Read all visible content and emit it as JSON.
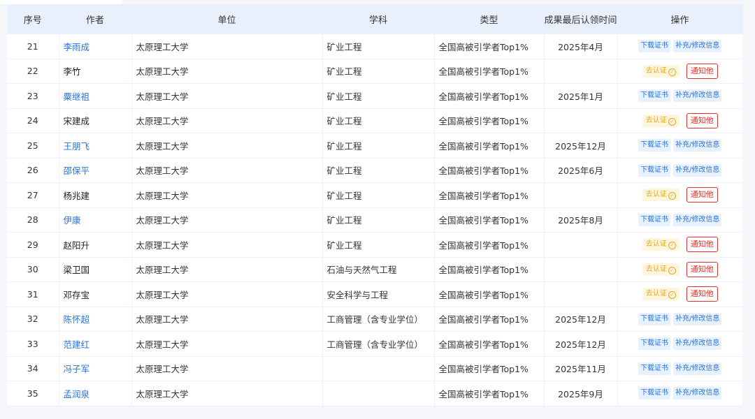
{
  "header": {
    "idx": "序号",
    "author": "作者",
    "unit": "单位",
    "subject": "学科",
    "type": "类型",
    "time": "成果最后认领时间",
    "ops": "操作"
  },
  "buttons": {
    "download": "下载证书",
    "edit": "补充/修改信息",
    "verify": "去认证",
    "notify": "通知他"
  },
  "colors": {
    "link": "#2a73d8",
    "notify": "#e0302a",
    "verify": "#e4a62a",
    "header_bg": "#eaf0fb"
  },
  "rows": [
    {
      "idx": "21",
      "author": "李雨成",
      "unit": "太原理工大学",
      "subject": "矿业工程",
      "type": "全国高被引学者Top1%",
      "time": "2025年4月",
      "claimed": true
    },
    {
      "idx": "22",
      "author": "李竹",
      "unit": "太原理工大学",
      "subject": "矿业工程",
      "type": "全国高被引学者Top1%",
      "time": "",
      "claimed": false
    },
    {
      "idx": "23",
      "author": "粟继祖",
      "unit": "太原理工大学",
      "subject": "矿业工程",
      "type": "全国高被引学者Top1%",
      "time": "2025年1月",
      "claimed": true
    },
    {
      "idx": "24",
      "author": "宋建成",
      "unit": "太原理工大学",
      "subject": "矿业工程",
      "type": "全国高被引学者Top1%",
      "time": "",
      "claimed": false
    },
    {
      "idx": "25",
      "author": "王朋飞",
      "unit": "太原理工大学",
      "subject": "矿业工程",
      "type": "全国高被引学者Top1%",
      "time": "2025年12月",
      "claimed": true
    },
    {
      "idx": "26",
      "author": "邵保平",
      "unit": "太原理工大学",
      "subject": "矿业工程",
      "type": "全国高被引学者Top1%",
      "time": "2025年6月",
      "claimed": true
    },
    {
      "idx": "27",
      "author": "杨兆建",
      "unit": "太原理工大学",
      "subject": "矿业工程",
      "type": "全国高被引学者Top1%",
      "time": "",
      "claimed": false
    },
    {
      "idx": "28",
      "author": "伊康",
      "unit": "太原理工大学",
      "subject": "矿业工程",
      "type": "全国高被引学者Top1%",
      "time": "2025年8月",
      "claimed": true
    },
    {
      "idx": "29",
      "author": "赵阳升",
      "unit": "太原理工大学",
      "subject": "矿业工程",
      "type": "全国高被引学者Top1%",
      "time": "",
      "claimed": false
    },
    {
      "idx": "30",
      "author": "梁卫国",
      "unit": "太原理工大学",
      "subject": "石油与天然气工程",
      "type": "全国高被引学者Top1%",
      "time": "",
      "claimed": false
    },
    {
      "idx": "31",
      "author": "邓存宝",
      "unit": "太原理工大学",
      "subject": "安全科学与工程",
      "type": "全国高被引学者Top1%",
      "time": "",
      "claimed": false
    },
    {
      "idx": "32",
      "author": "陈怀超",
      "unit": "太原理工大学",
      "subject": "工商管理（含专业学位）",
      "type": "全国高被引学者Top1%",
      "time": "2025年12月",
      "claimed": true
    },
    {
      "idx": "33",
      "author": "范建红",
      "unit": "太原理工大学",
      "subject": "工商管理（含专业学位）",
      "type": "全国高被引学者Top1%",
      "time": "2025年12月",
      "claimed": true
    },
    {
      "idx": "34",
      "author": "冯子军",
      "unit": "太原理工大学",
      "subject": "",
      "type": "全国高被引学者Top1%",
      "time": "2025年11月",
      "claimed": true
    },
    {
      "idx": "35",
      "author": "孟润泉",
      "unit": "太原理工大学",
      "subject": "",
      "type": "全国高被引学者Top1%",
      "time": "2025年9月",
      "claimed": true
    }
  ]
}
